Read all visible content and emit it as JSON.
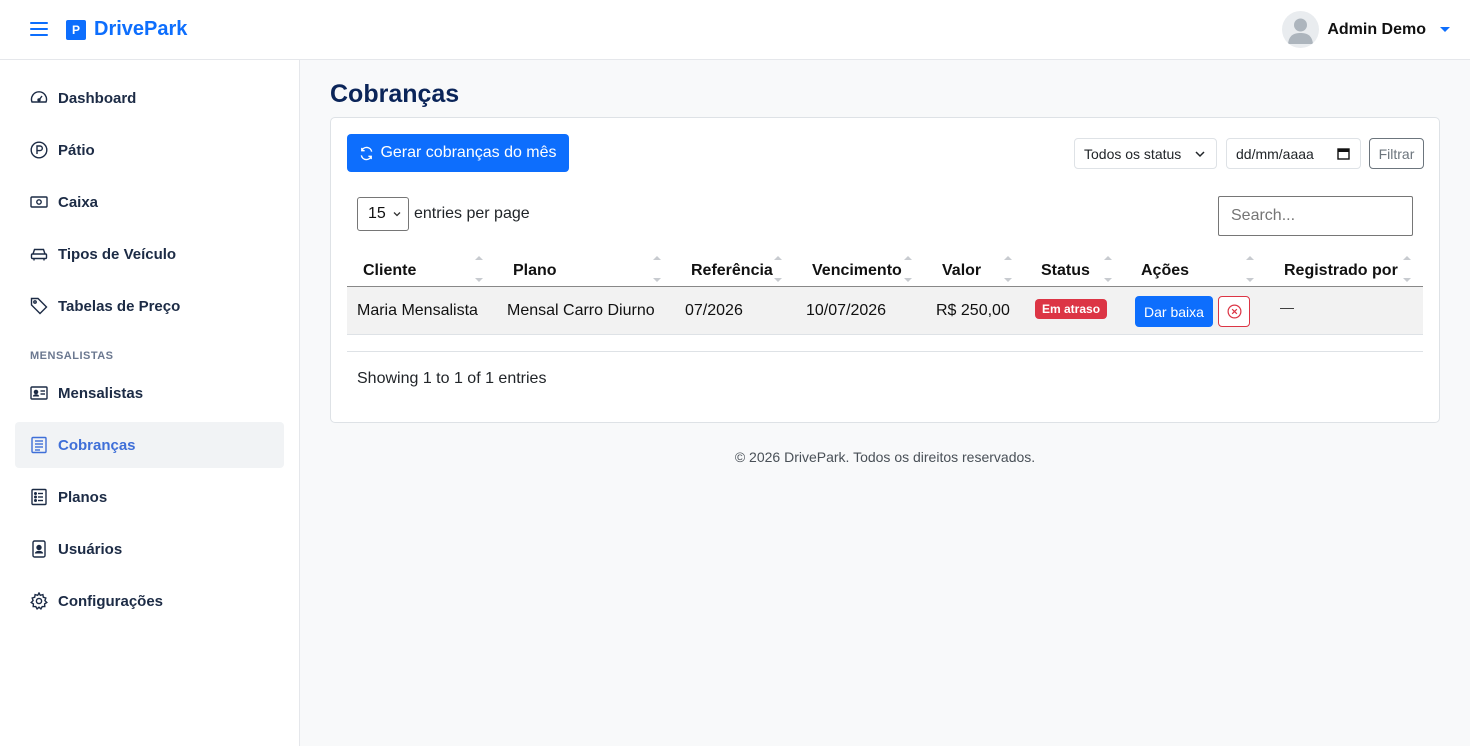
{
  "app": {
    "name": "DrivePark",
    "logo_letter": "P"
  },
  "header": {
    "user_name": "Admin Demo"
  },
  "sidebar": {
    "items": [
      {
        "label": "Dashboard",
        "icon": "speedometer-icon"
      },
      {
        "label": "Pátio",
        "icon": "parking-icon"
      },
      {
        "label": "Caixa",
        "icon": "cash-icon"
      },
      {
        "label": "Tipos de Veículo",
        "icon": "car-icon"
      },
      {
        "label": "Tabelas de Preço",
        "icon": "tag-icon"
      },
      {
        "label": "Mensalistas",
        "icon": "id-card-icon"
      },
      {
        "label": "Cobranças",
        "icon": "receipt-icon",
        "active": true
      },
      {
        "label": "Planos",
        "icon": "list-icon"
      },
      {
        "label": "Usuários",
        "icon": "person-badge-icon"
      },
      {
        "label": "Configurações",
        "icon": "gear-icon"
      }
    ],
    "section_label": "MENSALISTAS"
  },
  "main": {
    "title": "Cobranças",
    "generate_button": "Gerar cobranças do mês",
    "filters": {
      "status_select": "Todos os status",
      "date_placeholder": "dd/mm/aaaa",
      "filter_button": "Filtrar"
    },
    "table": {
      "per_page_value": "15",
      "per_page_label": "entries per page",
      "search_placeholder": "Search...",
      "columns": [
        "Cliente",
        "Plano",
        "Referência",
        "Vencimento",
        "Valor",
        "Status",
        "Ações",
        "Registrado por"
      ],
      "rows": [
        {
          "cliente": "Maria Mensalista",
          "plano": "Mensal Carro Diurno",
          "referencia": "07/2026",
          "vencimento": "10/07/2026",
          "valor": "R$ 250,00",
          "status": "Em atraso",
          "action_pay": "Dar baixa",
          "registrado_por": "—"
        }
      ],
      "info": "Showing 1 to 1 of 1 entries"
    }
  },
  "footer": {
    "text": "© 2026 DrivePark. Todos os direitos reservados."
  },
  "colors": {
    "primary": "#0d6efd",
    "danger": "#dc3545",
    "title": "#0b2559"
  }
}
